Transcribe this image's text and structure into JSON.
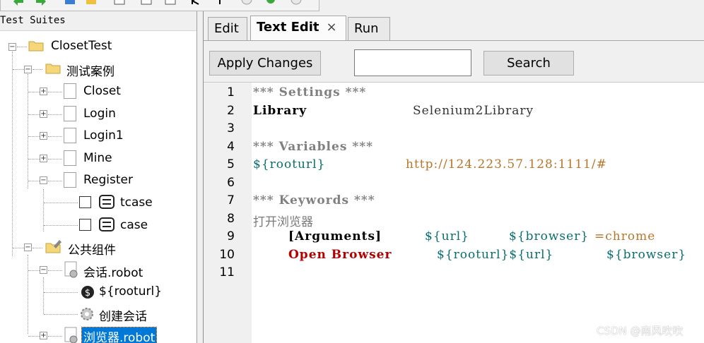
{
  "tree": {
    "header": "Test Suites",
    "items": [
      {
        "label": "ClosetTest"
      },
      {
        "label": "测试案例"
      },
      {
        "label": "Closet"
      },
      {
        "label": "Login"
      },
      {
        "label": "Login1"
      },
      {
        "label": "Mine"
      },
      {
        "label": "Register"
      },
      {
        "label": "tcase"
      },
      {
        "label": "case"
      },
      {
        "label": "公共组件"
      },
      {
        "label": "会话.robot"
      },
      {
        "label": "${rooturl}"
      },
      {
        "label": "创建会话"
      },
      {
        "label": "浏览器.robot"
      }
    ]
  },
  "tabs": {
    "edit": "Edit",
    "text_edit": "Text Edit",
    "close": "×",
    "run": "Run"
  },
  "buttons": {
    "apply": "Apply Changes",
    "search": "Search"
  },
  "search": {
    "value": ""
  },
  "editor": {
    "line_numbers": [
      "1",
      "2",
      "3",
      "4",
      "5",
      "6",
      "7",
      "8",
      "9",
      "10",
      "11"
    ],
    "lines": {
      "l1": "*** Settings ***",
      "l2a": "Library",
      "l2b": "Selenium2Library",
      "l4": "*** Variables ***",
      "l5a": "${rooturl}",
      "l5b": "http://124.223.57.128:1111/#",
      "l7": "*** Keywords ***",
      "l8": "打开浏览器",
      "l9a": "[Arguments]",
      "l9b": "${url}",
      "l9c": "${browser}",
      "l9d": "=chrome",
      "l10a": "Open Browser",
      "l10b": "${rooturl}${url}",
      "l10c": "${browser}"
    }
  },
  "watermark": "CSDN @南风吹吹",
  "colors": {
    "selection": "#0078d7",
    "keyword_red": "#b40000",
    "variable": "#0a6e6e",
    "url": "#b8762a"
  }
}
